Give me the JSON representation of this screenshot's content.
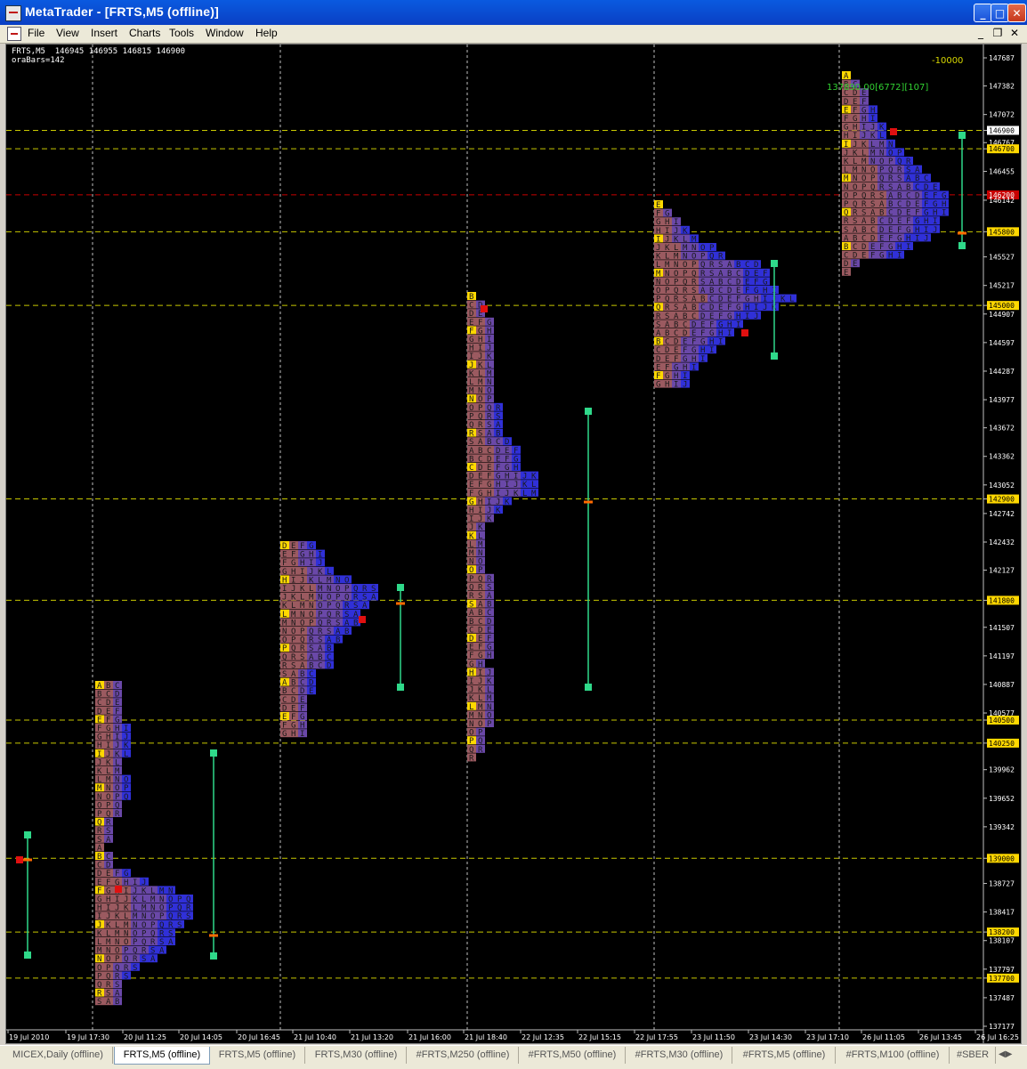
{
  "window": {
    "title": "MetaTrader - [FRTS,M5 (offline)]",
    "minimize": "_",
    "maximize": "□",
    "close": "✕"
  },
  "menu": [
    "File",
    "View",
    "Insert",
    "Charts",
    "Tools",
    "Window",
    "Help"
  ],
  "mdi_controls": [
    "_",
    "❐",
    "✕"
  ],
  "chart": {
    "info_line1": "FRTS,M5  146945 146955 146815 146900",
    "info_line2": "oraBars=142",
    "label_top_right": "-10000",
    "label_session_last": "137890.00[6772][107]",
    "price_axis": [
      "147687",
      "147382",
      "147072",
      "146900",
      "146767",
      "146700",
      "146455",
      "146200",
      "146142",
      "145800",
      "145527",
      "145217",
      "145000",
      "144907",
      "144597",
      "144287",
      "143977",
      "143672",
      "143362",
      "143052",
      "142900",
      "142742",
      "142432",
      "142127",
      "141800",
      "141507",
      "141197",
      "140887",
      "140577",
      "140500",
      "140250",
      "139962",
      "139652",
      "139342",
      "139000",
      "138727",
      "138417",
      "138200",
      "138107",
      "137797",
      "137700",
      "137487",
      "137177"
    ],
    "highlighted_prices": [
      "146900",
      "146700",
      "146200",
      "145800",
      "145000",
      "142900",
      "141800",
      "140500",
      "140250",
      "139000",
      "138200",
      "137700"
    ],
    "time_axis": [
      "19 Jul 2010",
      "19 Jul 17:30",
      "20 Jul 11:25",
      "20 Jul 14:05",
      "20 Jul 16:45",
      "21 Jul 10:40",
      "21 Jul 13:20",
      "21 Jul 16:00",
      "21 Jul 18:40",
      "22 Jul 12:35",
      "22 Jul 15:15",
      "22 Jul 17:55",
      "23 Jul 11:50",
      "23 Jul 14:30",
      "23 Jul 17:10",
      "26 Jul 11:05",
      "26 Jul 13:45",
      "26 Jul 16:25"
    ],
    "colors": {
      "background": "#000000",
      "level_line": "#c8c800",
      "red_line": "#c80000",
      "grid": "#c0c0c0",
      "va_bar": "#2fd98a",
      "poc_mark": "#ff6a00"
    }
  },
  "tabs": [
    "MICEX,Daily (offline)",
    "FRTS,M5 (offline)",
    "FRTS,M5 (offline)",
    "FRTS,M30 (offline)",
    "#FRTS,M250 (offline)",
    "#FRTS,M50 (offline)",
    "#FRTS,M30 (offline)",
    "#FRTS,M5 (offline)",
    "#FRTS,M100 (offline)",
    "#SBER"
  ]
}
